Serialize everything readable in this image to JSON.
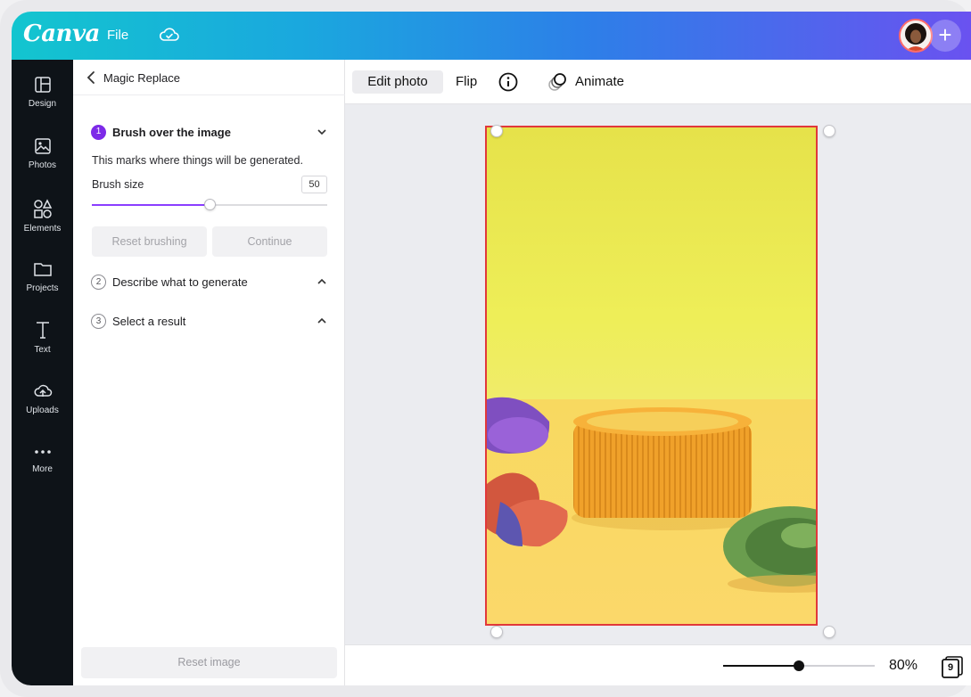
{
  "header": {
    "logo": "Canva",
    "file_label": "File",
    "cloud_icon": "cloud-check-icon",
    "add_label": "+"
  },
  "rail": {
    "items": [
      {
        "label": "Design",
        "icon": "layout-icon"
      },
      {
        "label": "Photos",
        "icon": "image-icon"
      },
      {
        "label": "Elements",
        "icon": "shapes-icon"
      },
      {
        "label": "Projects",
        "icon": "folder-icon"
      },
      {
        "label": "Text",
        "icon": "text-icon"
      },
      {
        "label": "Uploads",
        "icon": "cloud-upload-icon"
      },
      {
        "label": "More",
        "icon": "ellipsis-icon"
      }
    ]
  },
  "panel": {
    "title": "Magic Replace",
    "steps": [
      {
        "number": "1",
        "label": "Brush over the image",
        "expanded": true
      },
      {
        "number": "2",
        "label": "Describe what to generate",
        "expanded": false
      },
      {
        "number": "3",
        "label": "Select a result",
        "expanded": false
      }
    ],
    "description": "This marks where things will be generated.",
    "brush_size_label": "Brush size",
    "brush_size_value": "50",
    "brush_slider_fraction": 0.5,
    "reset_brushing_label": "Reset brushing",
    "continue_label": "Continue",
    "reset_image_label": "Reset image"
  },
  "toolbar": {
    "edit_photo_label": "Edit photo",
    "flip_label": "Flip",
    "info_icon": "info-icon",
    "animate_label": "Animate",
    "animate_icon": "animate-circles-icon"
  },
  "bottom": {
    "zoom_label": "80%",
    "zoom_fraction": 0.5,
    "pages_count": "9"
  },
  "colors": {
    "accent": "#7d2ae8",
    "selection": "#e1383a",
    "rail_bg": "#0e1318",
    "photo_bg": "#ece845"
  }
}
